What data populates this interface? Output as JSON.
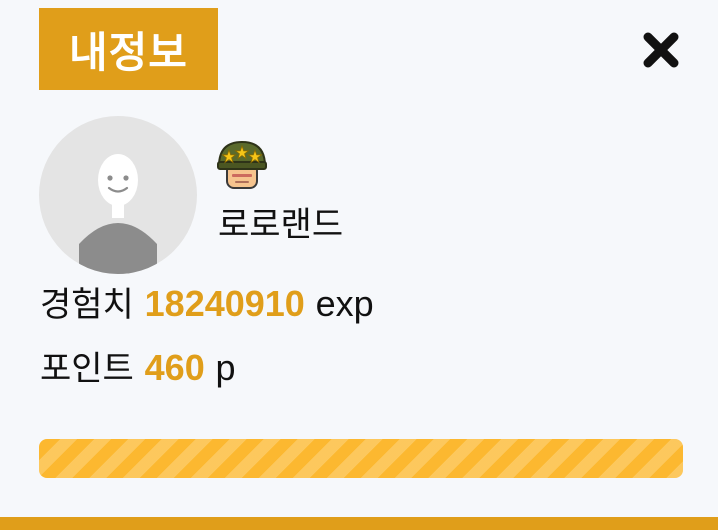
{
  "header": {
    "title": "내정보",
    "close_icon": "close-x-icon"
  },
  "profile": {
    "avatar_icon": "default-avatar-icon",
    "level_icon": "star-helmet-level-icon",
    "nickname": "로로랜드"
  },
  "stats": {
    "exp_label": "경험치",
    "exp_value": "18240910",
    "exp_unit": "exp",
    "point_label": "포인트",
    "point_value": "460",
    "point_unit": "p"
  },
  "progress": {
    "value_percent": 100
  },
  "colors": {
    "accent": "#e09e1a",
    "progress": "#fcb830",
    "background": "#f6f8fb",
    "avatar_bg": "#e4e4e4"
  }
}
